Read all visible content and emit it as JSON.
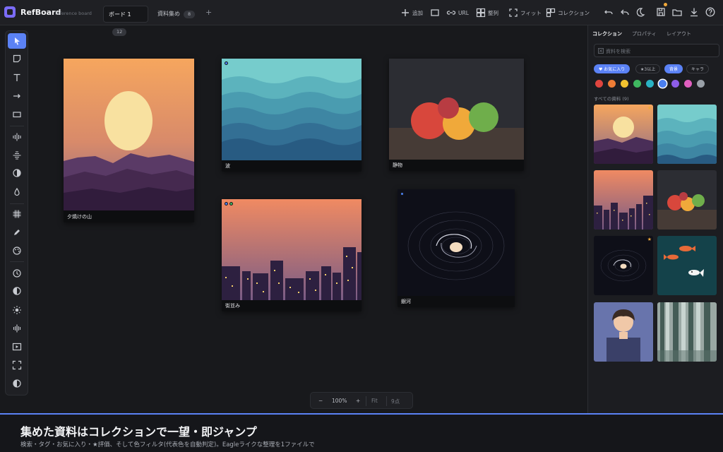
{
  "header": {
    "app_name": "RefBoard",
    "app_subtitle": "reference board",
    "tabs": [
      {
        "label": "ボード 1",
        "count": "12"
      },
      {
        "label": "資料集め",
        "count": "8"
      }
    ],
    "add_tab": "+",
    "actions": {
      "add": "追加",
      "url": "URL",
      "arrange": "整列",
      "fit": "フィット",
      "collection": "コレクション"
    }
  },
  "canvas": {
    "cards": [
      {
        "caption": "夕焼けの山"
      },
      {
        "caption": "波"
      },
      {
        "caption": "静物"
      },
      {
        "caption": "街並み"
      },
      {
        "caption": "銀河"
      }
    ]
  },
  "zoombar": {
    "minus": "−",
    "zoom": "100%",
    "plus": "+",
    "fit": "Fit",
    "count": "9点"
  },
  "panel": {
    "tabs": [
      "コレクション",
      "プロパティ",
      "レイアウト"
    ],
    "search_placeholder": "資料を検索",
    "chips": [
      "♥ お気に入り",
      "★3以上",
      "背景",
      "キャラ"
    ],
    "all_items": "すべての資料 (9)",
    "colors": [
      "#e0453f",
      "#ef7d36",
      "#f2c230",
      "#3fb860",
      "#2ab3c4",
      "#4a7ff0",
      "#8d5de8",
      "#e05fbf",
      "#9aa0a8"
    ]
  },
  "footer": {
    "title": "集めた資料はコレクションで一望・即ジャンプ",
    "subtitle": "検索・タグ・お気に入り・★評価、そして色フィルタ(代表色を自動判定)。Eagleライクな整理を1ファイルで"
  }
}
